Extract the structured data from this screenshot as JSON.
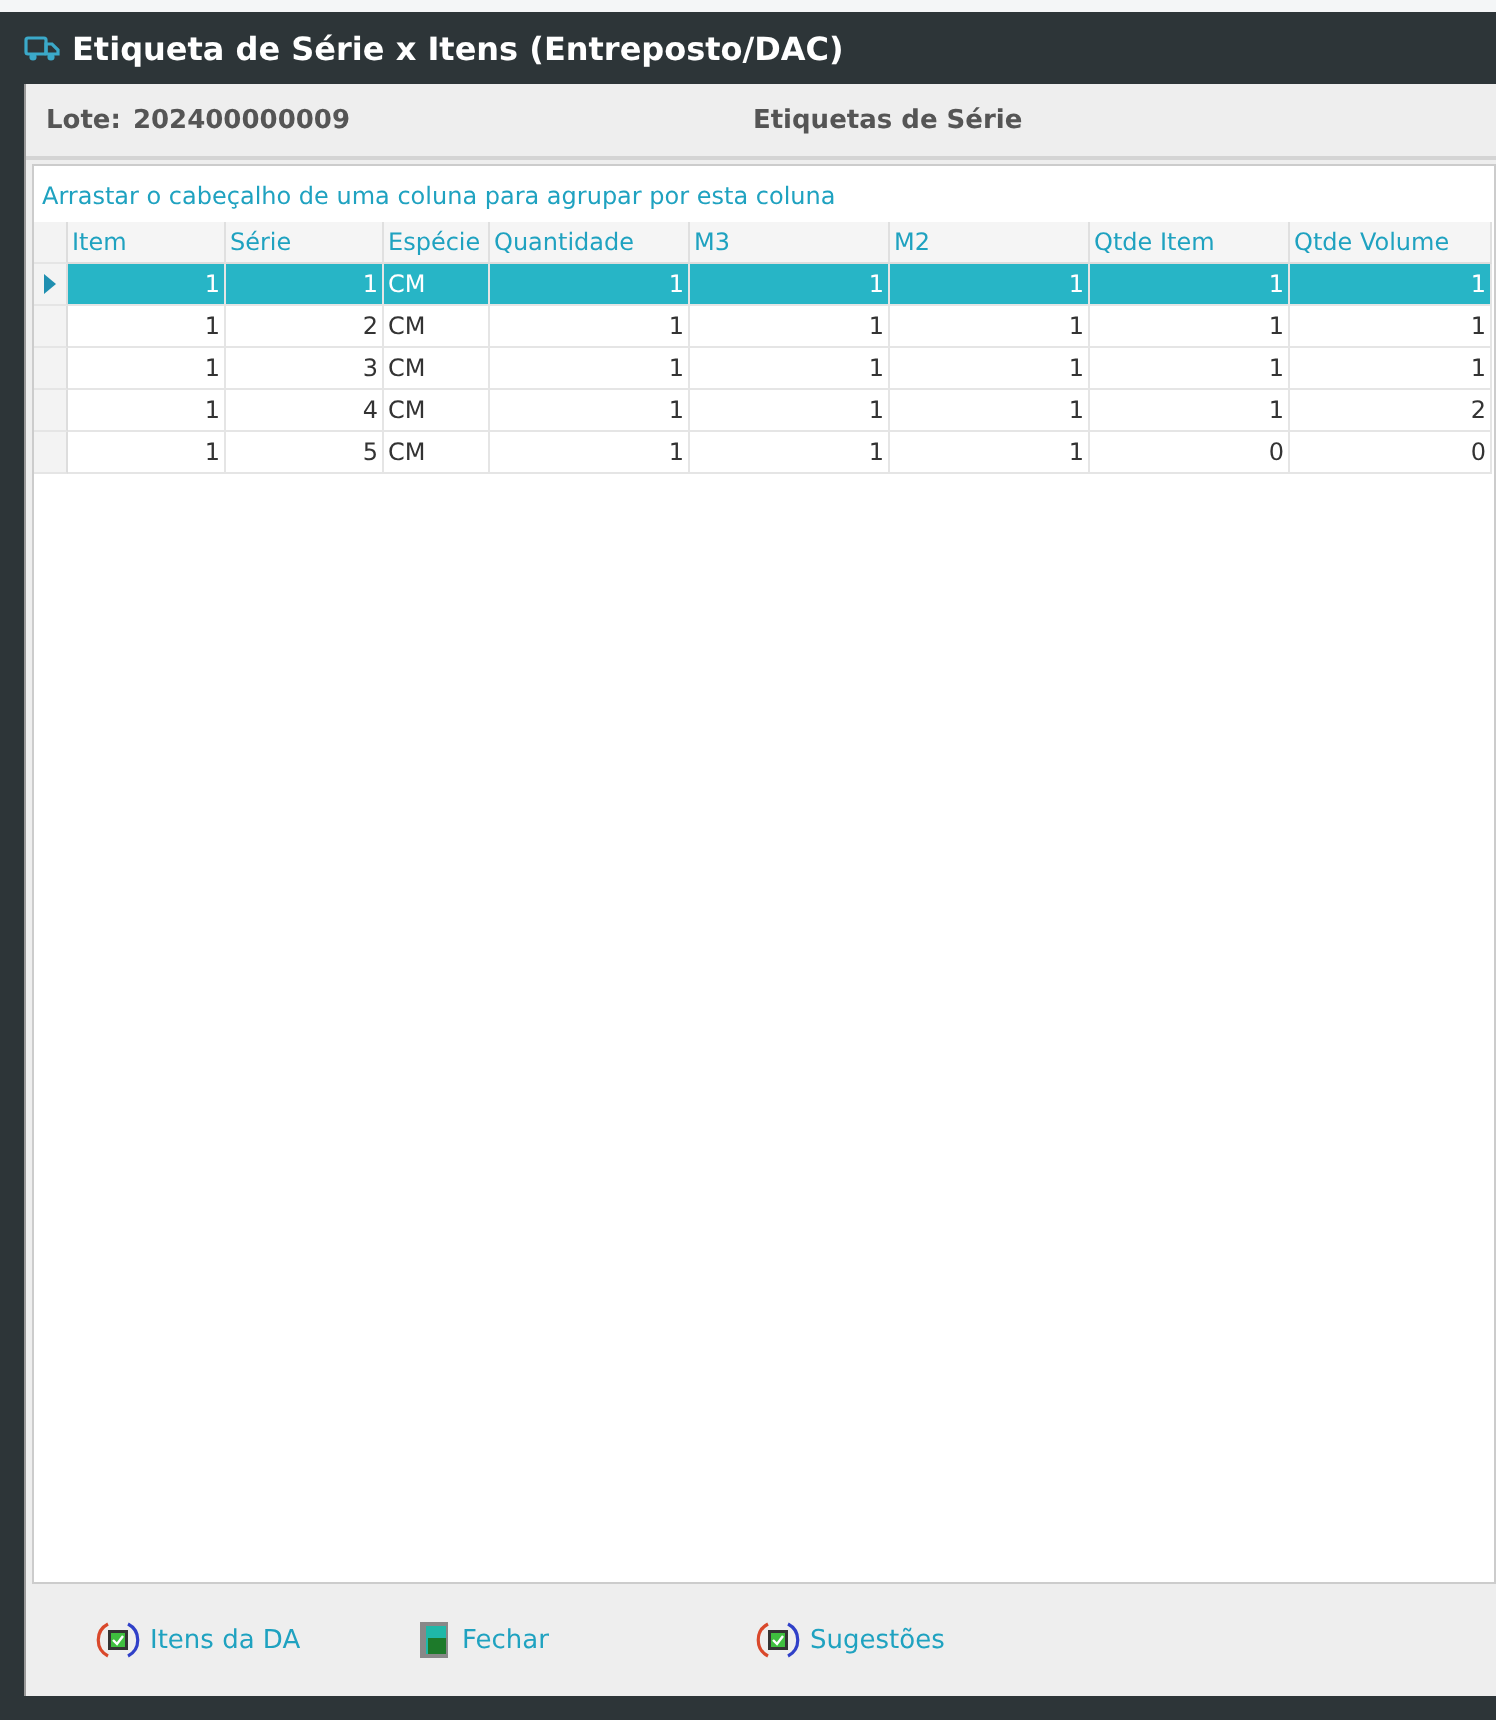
{
  "window": {
    "title": "Etiqueta de Série x Itens (Entreposto/DAC)"
  },
  "header": {
    "lot_label": "Lote:",
    "lot_value": "202400000009",
    "section_title": "Etiquetas de Série"
  },
  "grid": {
    "group_hint": "Arrastar o cabeçalho de uma coluna para agrupar por esta coluna",
    "columns": [
      {
        "label": "Item",
        "kind": "number"
      },
      {
        "label": "Série",
        "kind": "number"
      },
      {
        "label": "Espécie",
        "kind": "text"
      },
      {
        "label": "Quantidade",
        "kind": "number"
      },
      {
        "label": "M3",
        "kind": "number"
      },
      {
        "label": "M2",
        "kind": "number"
      },
      {
        "label": "Qtde Item",
        "kind": "number"
      },
      {
        "label": "Qtde Volume",
        "kind": "number"
      }
    ],
    "rows": [
      {
        "selected": true,
        "cells": [
          "1",
          "1",
          "CM",
          "1",
          "1",
          "1",
          "1",
          "1"
        ]
      },
      {
        "selected": false,
        "cells": [
          "1",
          "2",
          "CM",
          "1",
          "1",
          "1",
          "1",
          "1"
        ]
      },
      {
        "selected": false,
        "cells": [
          "1",
          "3",
          "CM",
          "1",
          "1",
          "1",
          "1",
          "1"
        ]
      },
      {
        "selected": false,
        "cells": [
          "1",
          "4",
          "CM",
          "1",
          "1",
          "1",
          "1",
          "2"
        ]
      },
      {
        "selected": false,
        "cells": [
          "1",
          "5",
          "CM",
          "1",
          "1",
          "1",
          "0",
          "0"
        ]
      }
    ]
  },
  "buttons": [
    {
      "kind": "refresh",
      "label": "Itens da DA"
    },
    {
      "kind": "exit",
      "label": "Fechar"
    },
    {
      "kind": "refresh",
      "label": "Sugestões"
    }
  ]
}
